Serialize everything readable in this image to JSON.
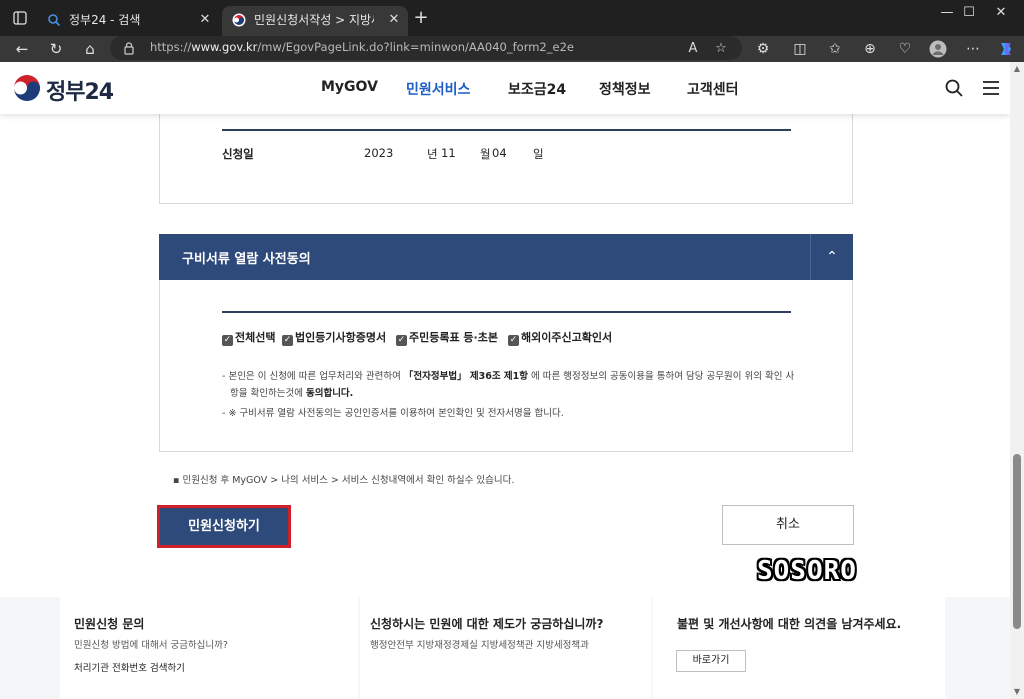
{
  "browser": {
    "tabs": [
      {
        "title": "정부24 - 검색",
        "active": false
      },
      {
        "title": "민원신청서작성 > 지방세 납세증",
        "active": true
      }
    ],
    "url_prefix": "https://",
    "url_domain": "www.gov.kr",
    "url_path": "/mw/EgovPageLink.do?link=minwon/AA040_form2_e2e"
  },
  "site": {
    "logo_text": "정부24",
    "nav": [
      "MyGOV",
      "민원서비스",
      "보조금24",
      "정책정보",
      "고객센터"
    ],
    "active_nav": "민원서비스"
  },
  "application": {
    "date_label": "신청일",
    "year": "2023",
    "year_unit": "년",
    "month": "11",
    "month_unit": "월",
    "day": "04",
    "day_unit": "일"
  },
  "consent": {
    "title": "구비서류 열람 사전동의",
    "checkboxes": [
      "전체선택",
      "법인등기사항증명서",
      "주민등록표 등·초본",
      "해외이주신고확인서"
    ],
    "note1_pre": "본인은 이 신청에 따른 업무처리와 관련하여 ",
    "note1_bold": "「전자정부법」 제36조 제1항",
    "note1_post": " 에 따른 행정정보의 공동이용을 통하여 담당 공무원이 위의 확인 사",
    "note1_line2_pre": "항을 확인하는것에 ",
    "note1_line2_bold": "동의합니다.",
    "note2": "※ 구비서류 열람 사전동의는 공인인증서를 이용하여 본인확인 및 전자서명을 합니다."
  },
  "footer_note": "민원신청 후 MyGOV > 나의 서비스 > 서비스 신청내역에서 확인 하실수 있습니다.",
  "buttons": {
    "apply": "민원신청하기",
    "cancel": "취소"
  },
  "watermark": "SOSORO",
  "bottom": {
    "col1": {
      "title": "민원신청 문의",
      "sub": "민원신청 방법에 대해서 궁금하십니까?",
      "link": "처리기관 전화번호 검색하기"
    },
    "col2": {
      "title": "신청하시는 민원에 대한 제도가 궁금하십니까?",
      "sub": "행정안전부 지방재정경제실 지방세정책관 지방세정책과"
    },
    "col3": {
      "title": "불편 및 개선사항에 대한 의견을 남겨주세요.",
      "button": "바로가기"
    }
  }
}
